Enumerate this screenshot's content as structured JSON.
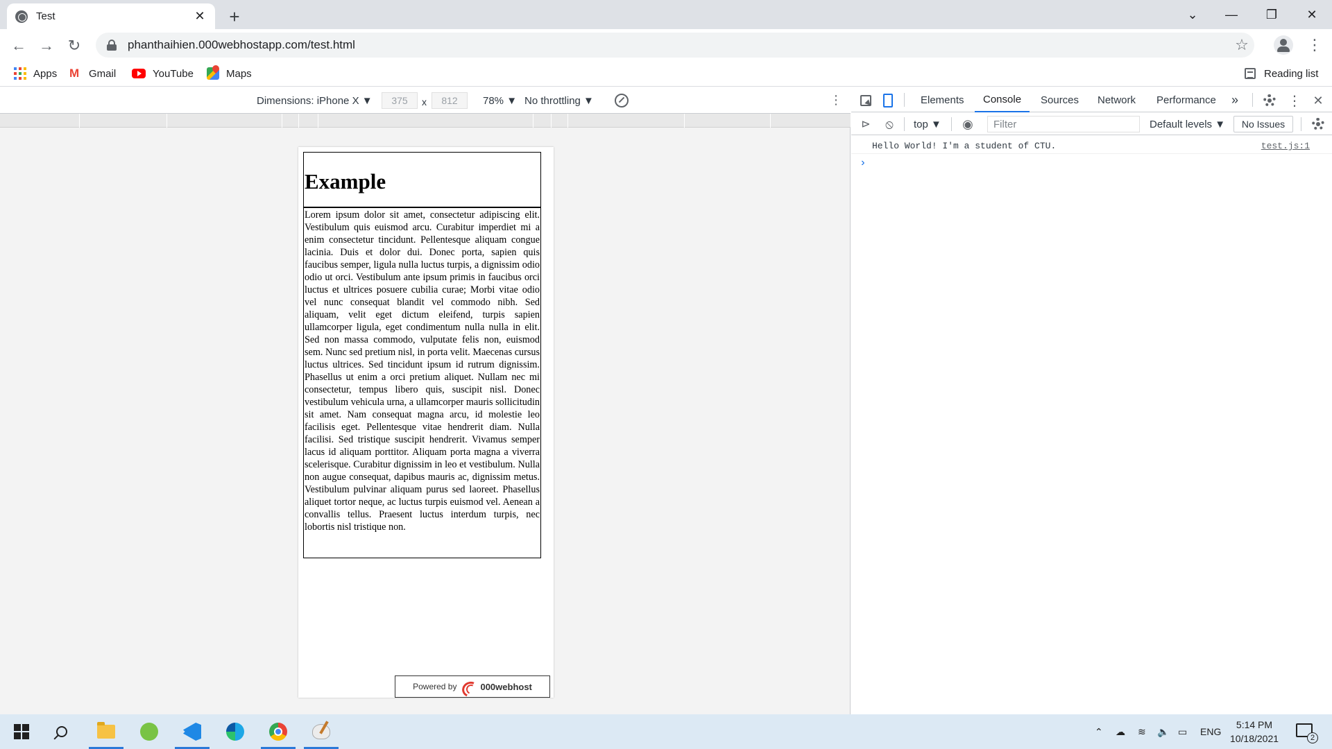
{
  "browser": {
    "tab_title": "Test",
    "url": "phanthaihien.000webhostapp.com/test.html",
    "bookmarks": [
      {
        "label": "Apps"
      },
      {
        "label": "Gmail"
      },
      {
        "label": "YouTube"
      },
      {
        "label": "Maps"
      }
    ],
    "reading_list_label": "Reading list"
  },
  "device_toolbar": {
    "dimensions_label": "Dimensions: iPhone X ▼",
    "width": "375",
    "height": "812",
    "times": "x",
    "zoom": "78% ▼",
    "throttling": "No throttling ▼"
  },
  "page": {
    "heading": "Example",
    "body_text": "Lorem ipsum dolor sit amet, consectetur adipiscing elit. Vestibulum quis euismod arcu. Curabitur imperdiet mi a enim consectetur tincidunt. Pellentesque aliquam congue lacinia. Duis et dolor dui. Donec porta, sapien quis faucibus semper, ligula nulla luctus turpis, a dignissim odio odio ut orci. Vestibulum ante ipsum primis in faucibus orci luctus et ultrices posuere cubilia curae; Morbi vitae odio vel nunc consequat blandit vel commodo nibh. Sed aliquam, velit eget dictum eleifend, turpis sapien ullamcorper ligula, eget condimentum nulla nulla in elit. Sed non massa commodo, vulputate felis non, euismod sem. Nunc sed pretium nisl, in porta velit. Maecenas cursus luctus ultrices. Sed tincidunt ipsum id rutrum dignissim. Phasellus ut enim a orci pretium aliquet. Nullam nec mi consectetur, tempus libero quis, suscipit nisl. Donec vestibulum vehicula urna, a ullamcorper mauris sollicitudin sit amet. Nam consequat magna arcu, id molestie leo facilisis eget. Pellentesque vitae hendrerit diam. Nulla facilisi. Sed tristique suscipit hendrerit. Vivamus semper lacus id aliquam porttitor. Aliquam porta magna a viverra scelerisque. Curabitur dignissim in leo et vestibulum. Nulla non augue consequat, dapibus mauris ac, dignissim metus. Vestibulum pulvinar aliquam purus sed laoreet. Phasellus aliquet tortor neque, ac luctus turpis euismod vel. Aenean a convallis tellus. Praesent luctus interdum turpis, nec lobortis nisl tristique non.",
    "powered_by": "Powered by",
    "powered_brand": "000webhost"
  },
  "devtools": {
    "tabs": [
      {
        "label": "Elements",
        "active": false
      },
      {
        "label": "Console",
        "active": true
      },
      {
        "label": "Sources",
        "active": false
      },
      {
        "label": "Network",
        "active": false
      },
      {
        "label": "Performance",
        "active": false
      }
    ],
    "more_tabs": "»",
    "context": "top ▼",
    "filter_placeholder": "Filter",
    "levels": "Default levels ▼",
    "issues": "No Issues",
    "console_message": "Hello World! I'm a student of CTU.",
    "console_source": "test.js:1",
    "prompt": "›"
  },
  "taskbar": {
    "language": "ENG",
    "time": "5:14 PM",
    "date": "10/18/2021",
    "notification_count": "2"
  },
  "colors": {
    "accent": "#1a73e8",
    "tabstrip_bg": "#dee1e6",
    "taskbar_bg": "#dce9f4"
  }
}
